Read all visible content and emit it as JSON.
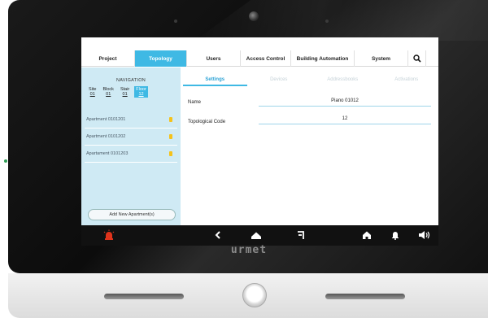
{
  "device": {
    "brand": "urmet"
  },
  "topnav": {
    "tabs": [
      "Project",
      "Topology",
      "Users",
      "Access Control",
      "Building Automation",
      "System"
    ],
    "active_tab": "Topology",
    "search_icon": "search-icon"
  },
  "navigation": {
    "title": "NAVIGATION",
    "crumbs": [
      {
        "label": "Site",
        "value": "01"
      },
      {
        "label": "Block",
        "value": "01"
      },
      {
        "label": "Stair",
        "value": "01"
      },
      {
        "label": "Floor",
        "value": "12"
      }
    ],
    "apartments": [
      "Apartment 0101201",
      "Apartment 0101202",
      "Apartament 0101203"
    ],
    "add_button": "Add New Apartment(s)"
  },
  "subtabs": [
    "Settings",
    "Devices",
    "Addressbooks",
    "Activations"
  ],
  "settings": {
    "name_label": "Name",
    "name_value": "Piano 01012",
    "code_label": "Topological Code",
    "code_value": "12"
  },
  "bottombar": {
    "icons": [
      "alarm-icon",
      "back-icon",
      "home-cloud-icon",
      "exit-icon",
      "house-icon",
      "bell-icon",
      "volume-icon"
    ]
  },
  "colors": {
    "accent": "#3fb9e4",
    "panel": "#cfeaf4",
    "lock": "#f5c21a",
    "alarm": "#e0331b"
  }
}
